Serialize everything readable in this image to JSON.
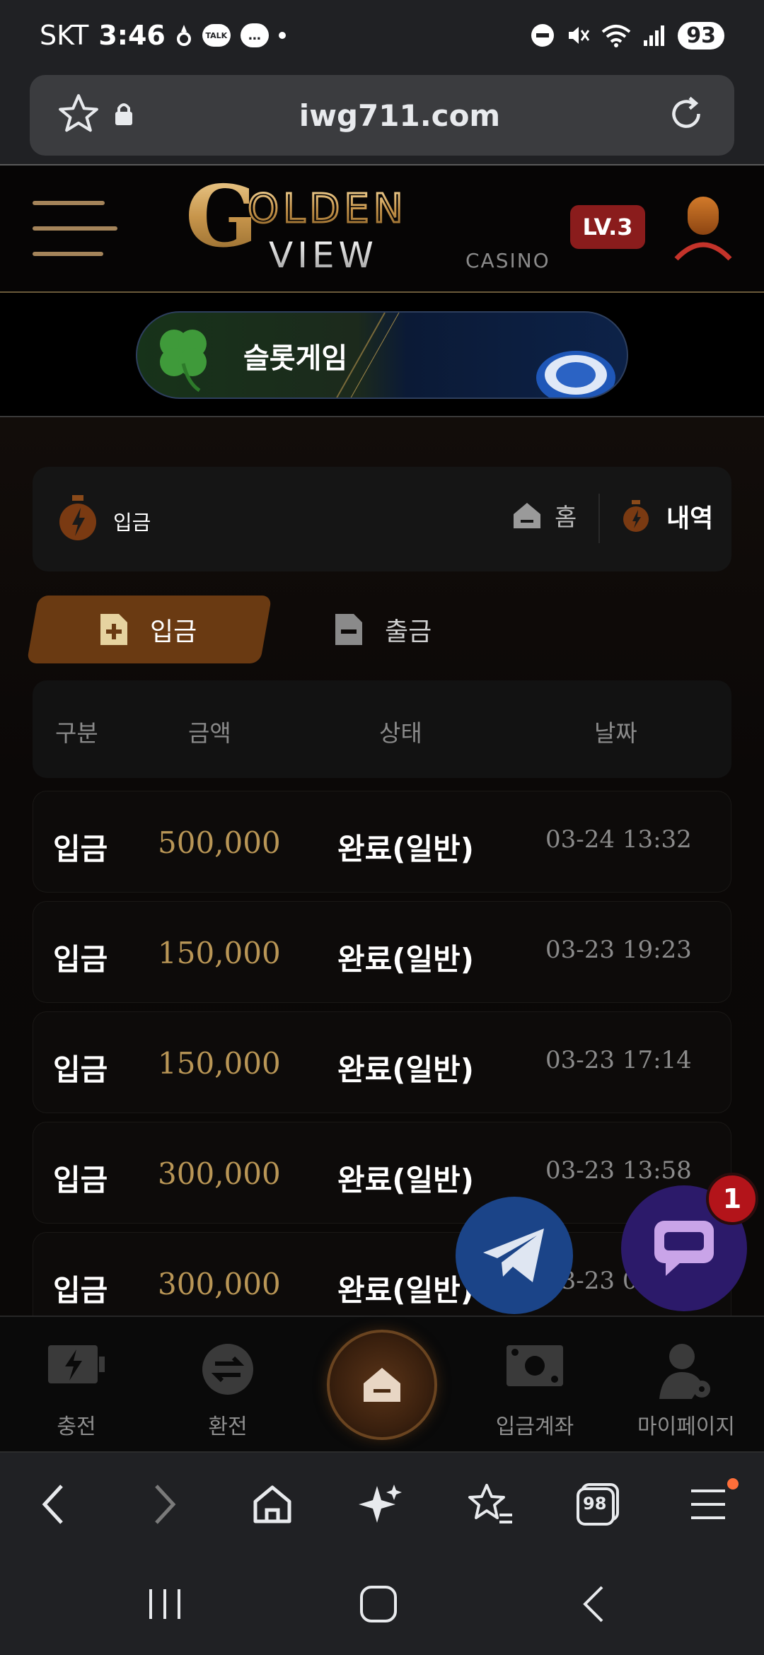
{
  "status_bar": {
    "carrier": "SKT",
    "time": "3:46",
    "battery": "93",
    "talk_icon_text": "TALK"
  },
  "browser": {
    "url": "iwg711.com",
    "tabs_count": "98"
  },
  "header": {
    "logo_text": "GOLDEN VIEW",
    "logo_sub": "CASINO",
    "level_badge": "LV.3"
  },
  "banner": {
    "label": "슬롯게임"
  },
  "subnav": {
    "title": "입금",
    "home_label": "홈",
    "history_label": "내역"
  },
  "tabs": {
    "deposit": "입금",
    "withdraw": "출금"
  },
  "table": {
    "headers": [
      "구분",
      "금액",
      "상태",
      "날짜"
    ],
    "rows": [
      {
        "type": "입금",
        "amount": "500,000",
        "status": "완료(일반)",
        "date": "03-24 13:32"
      },
      {
        "type": "입금",
        "amount": "150,000",
        "status": "완료(일반)",
        "date": "03-23 19:23"
      },
      {
        "type": "입금",
        "amount": "150,000",
        "status": "완료(일반)",
        "date": "03-23 17:14"
      },
      {
        "type": "입금",
        "amount": "300,000",
        "status": "완료(일반)",
        "date": "03-23 13:58"
      },
      {
        "type": "입금",
        "amount": "300,000",
        "status": "완료(일반)",
        "date": "03-23 0"
      }
    ]
  },
  "floating": {
    "chat_badge": "1"
  },
  "bottom_nav": {
    "charge": "충전",
    "exchange": "환전",
    "deposit_account": "입금계좌",
    "mypage": "마이페이지"
  },
  "colors": {
    "gold": "#b99656",
    "accent_tab": "#6a3a12",
    "badge_red": "#8a1c1c"
  }
}
